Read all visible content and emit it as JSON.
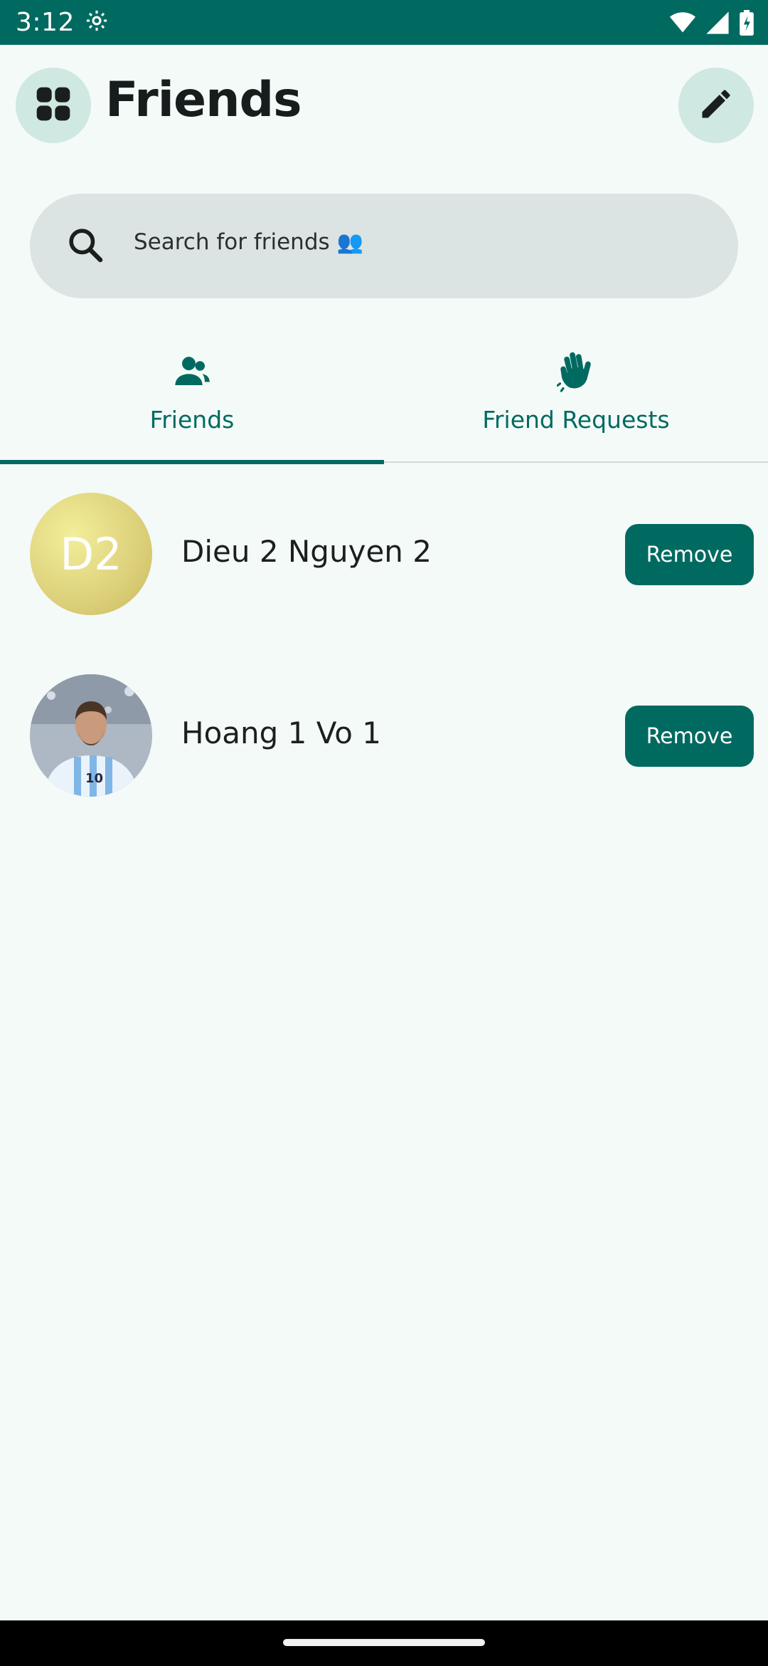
{
  "status_bar": {
    "time": "3:12",
    "icons": [
      "settings-gear-icon",
      "wifi-icon",
      "cellular-signal-icon",
      "battery-charging-icon"
    ]
  },
  "header": {
    "title": "Friends",
    "menu_icon": "grid-apps-icon",
    "edit_icon": "pencil-icon"
  },
  "search": {
    "placeholder": "Search for friends",
    "emoji": "👥"
  },
  "tabs": [
    {
      "label": "Friends",
      "icon": "people-icon",
      "selected": true
    },
    {
      "label": "Friend Requests",
      "icon": "waving-hand-icon",
      "selected": false
    }
  ],
  "friends": [
    {
      "name": "Dieu 2 Nguyen 2",
      "avatar_type": "initials",
      "initials": "D2",
      "action_label": "Remove"
    },
    {
      "name": "Hoang 1 Vo 1",
      "avatar_type": "photo",
      "action_label": "Remove"
    }
  ],
  "colors": {
    "primary": "#006a60",
    "background": "#f4faf8",
    "search_bg": "#dbe4e2",
    "icon_button_bg": "#cfe8e2"
  }
}
